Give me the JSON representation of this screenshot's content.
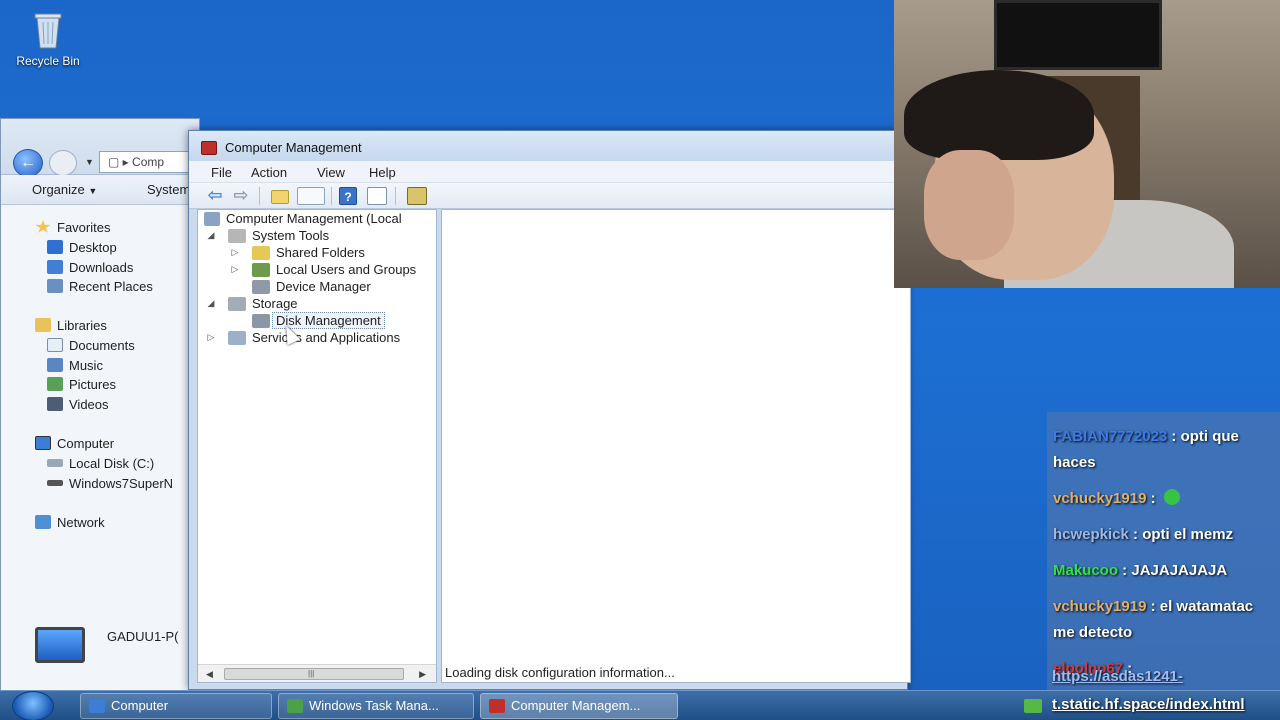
{
  "desktop": {
    "recycle_bin_label": "Recycle Bin"
  },
  "explorer": {
    "address_text": "Comp",
    "organize_label": "Organize",
    "system_label": "System",
    "nav_items": [
      {
        "label": "Favorites",
        "icon": "star-icon"
      },
      {
        "label": "Desktop",
        "icon": "desktop-icon"
      },
      {
        "label": "Downloads",
        "icon": "downloads-icon"
      },
      {
        "label": "Recent Places",
        "icon": "recent-places-icon"
      },
      {
        "label": "Libraries",
        "icon": "libraries-icon"
      },
      {
        "label": "Documents",
        "icon": "documents-icon"
      },
      {
        "label": "Music",
        "icon": "music-icon"
      },
      {
        "label": "Pictures",
        "icon": "pictures-icon"
      },
      {
        "label": "Videos",
        "icon": "videos-icon"
      },
      {
        "label": "Computer",
        "icon": "computer-icon"
      },
      {
        "label": "Local Disk (C:)",
        "icon": "drive-icon"
      },
      {
        "label": "Windows7SuperN",
        "icon": "drive-icon"
      },
      {
        "label": "Network",
        "icon": "network-icon"
      }
    ],
    "computer_name": "GADUU1-P("
  },
  "cm": {
    "title": "Computer Management",
    "menu": {
      "file": "File",
      "action": "Action",
      "view": "View",
      "help": "Help"
    },
    "toolbar": {
      "help_glyph": "?"
    },
    "tree": {
      "root": "Computer Management (Local",
      "system_tools": "System Tools",
      "shared_folders": "Shared Folders",
      "local_users_groups": "Local Users and Groups",
      "device_manager": "Device Manager",
      "storage": "Storage",
      "disk_management": "Disk Management",
      "services_apps": "Services and Applications"
    },
    "status_text": "Loading disk configuration information..."
  },
  "chat": {
    "messages": [
      {
        "user": "FABIAN7772023",
        "text": "opti que haces",
        "color": "#3d7be6"
      },
      {
        "user": "vchucky1919",
        "text": "",
        "color": "#e0b06a",
        "emoji": "smile-emoji-icon"
      },
      {
        "user": "hcwepkick",
        "text": "opti el memz",
        "color": "#9fb8e8"
      },
      {
        "user": "Makucoo",
        "text": "JAJAJAJAJA",
        "color": "#31e24a"
      },
      {
        "user": "vchucky1919",
        "text": "el watamatac me detecto",
        "color": "#e0b06a"
      },
      {
        "user": "elpolno67",
        "text": "",
        "color": "#d43c3c"
      }
    ],
    "link_line1": "https://asdas1241-",
    "link_line2": "t.static.hf.space/index.html"
  },
  "taskbar": {
    "buttons": [
      {
        "label": "Computer",
        "icon": "computer-icon"
      },
      {
        "label": "Windows Task Mana...",
        "icon": "task-manager-icon"
      },
      {
        "label": "Computer Managem...",
        "icon": "computer-management-icon"
      }
    ]
  }
}
